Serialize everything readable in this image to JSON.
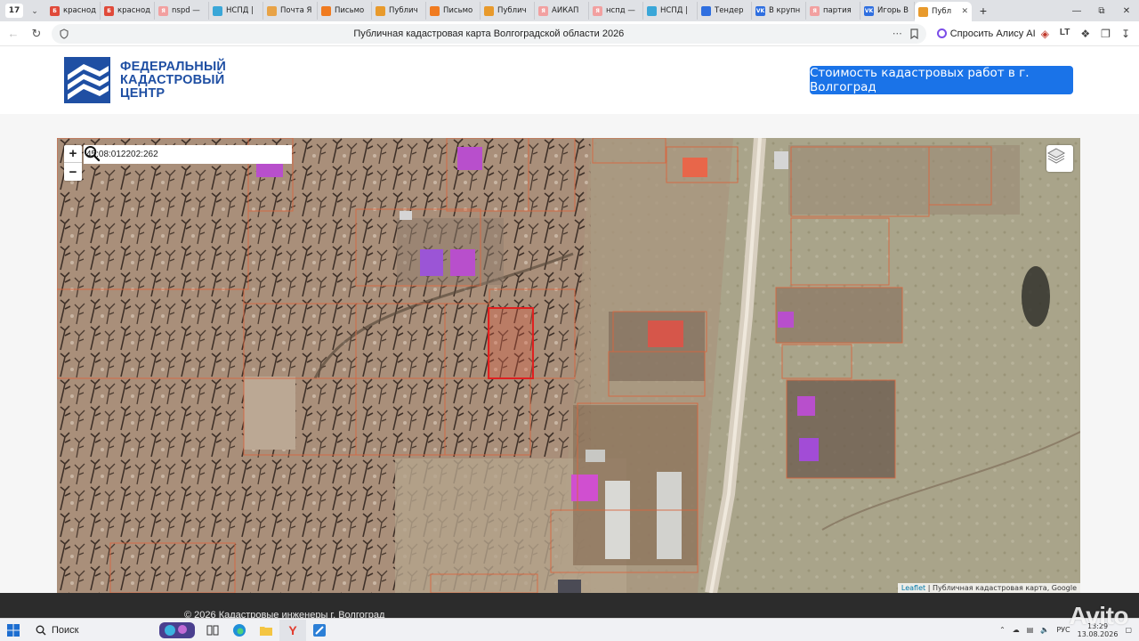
{
  "browser": {
    "tab_count": "17",
    "tabs": [
      {
        "label": "краснод",
        "color": "#e04a3a",
        "glyph": "Б"
      },
      {
        "label": "краснод",
        "color": "#e04a3a",
        "glyph": "Б"
      },
      {
        "label": "nspd —",
        "color": "#f2a0a0",
        "glyph": "Я"
      },
      {
        "label": "НСПД |",
        "color": "#3aa7d8",
        "glyph": ""
      },
      {
        "label": "Почта Я",
        "color": "#e8a347",
        "glyph": ""
      },
      {
        "label": "Письмо",
        "color": "#f07b20",
        "glyph": ""
      },
      {
        "label": "Публич",
        "color": "#e89a2c",
        "glyph": ""
      },
      {
        "label": "Письмо",
        "color": "#f07b20",
        "glyph": ""
      },
      {
        "label": "Публич",
        "color": "#e89a2c",
        "glyph": ""
      },
      {
        "label": "АЙКАП",
        "color": "#f2a0a0",
        "glyph": "Я"
      },
      {
        "label": "нспд —",
        "color": "#f2a0a0",
        "glyph": "Я"
      },
      {
        "label": "НСПД |",
        "color": "#3aa7d8",
        "glyph": ""
      },
      {
        "label": "Тендер",
        "color": "#2f6fe0",
        "glyph": ""
      },
      {
        "label": "В крупн",
        "color": "#2f6fe0",
        "glyph": "VK"
      },
      {
        "label": "партия",
        "color": "#f2a0a0",
        "glyph": "Я"
      },
      {
        "label": "Игорь В",
        "color": "#2f6fe0",
        "glyph": "VK"
      },
      {
        "label": "Публ",
        "color": "#e89a2c",
        "glyph": "",
        "active": true
      }
    ],
    "page_title": "Публичная кадастровая карта Волгоградской области 2026",
    "alice_label": "Спросить Алису AI"
  },
  "header": {
    "logo_lines": [
      "ФЕДЕРАЛЬНЫЙ",
      "КАДАСТРОВЫЙ",
      "ЦЕНТР"
    ],
    "cta_label": "Стоимость кадастровых работ в г. Волгоград",
    "brand_color": "#1f4fa3",
    "cta_color": "#1a73e8"
  },
  "map": {
    "search_value": "45:08:012202:262",
    "zoom_in": "+",
    "zoom_out": "−",
    "attribution_link": "Leaflet",
    "attribution_text": " | Публичная кадастровая карта, Google",
    "parcel_color": "#e02020",
    "boundary_color": "#d9663f"
  },
  "footer": {
    "copyright": "© 2026 Кадастровые инженеры г. Волгоград"
  },
  "taskbar": {
    "search_label": "Поиск",
    "language": "РУС",
    "time": "13:29",
    "date": "13.08.2026"
  },
  "watermark": "Avito"
}
